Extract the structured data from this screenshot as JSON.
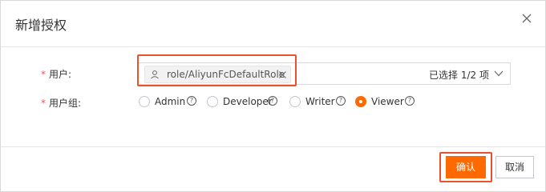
{
  "dialog": {
    "title": "新增授权",
    "close_icon": "close-icon"
  },
  "form": {
    "user": {
      "required_mark": "*",
      "label": "用户:",
      "selected_tag": "role/AliyunFcDefaultRole",
      "selection_count": "已选择 1/2 项"
    },
    "group": {
      "required_mark": "*",
      "label": "用户组:",
      "options": [
        {
          "label": "Admin",
          "checked": false
        },
        {
          "label": "Developer",
          "checked": false
        },
        {
          "label": "Writer",
          "checked": false
        },
        {
          "label": "Viewer",
          "checked": true
        }
      ],
      "help_glyph": "?"
    }
  },
  "footer": {
    "confirm_label": "确认",
    "cancel_label": "取消"
  },
  "colors": {
    "primary": "#ff6a00",
    "highlight": "#e8522f",
    "required": "#ff4d4f"
  }
}
